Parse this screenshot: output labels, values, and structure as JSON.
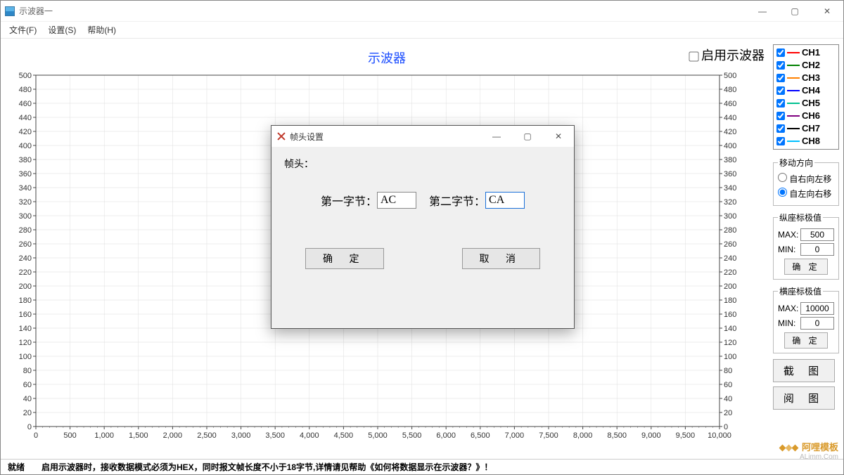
{
  "window": {
    "title": "示波器一"
  },
  "menubar": {
    "items": [
      "文件(F)",
      "设置(S)",
      "帮助(H)"
    ]
  },
  "chart": {
    "title": "示波器",
    "enable_label": "启用示波器",
    "enable_checked": false
  },
  "chart_data": {
    "type": "line",
    "title": "示波器",
    "xlabel": "",
    "ylabel": "",
    "xlim": [
      0,
      10000
    ],
    "ylim": [
      0,
      500
    ],
    "xticks": [
      0,
      500,
      1000,
      1500,
      2000,
      2500,
      3000,
      3500,
      4000,
      4500,
      5000,
      5500,
      6000,
      6500,
      7000,
      7500,
      8000,
      8500,
      9000,
      9500,
      10000
    ],
    "yticks": [
      0,
      20,
      40,
      60,
      80,
      100,
      120,
      140,
      160,
      180,
      200,
      220,
      240,
      260,
      280,
      300,
      320,
      340,
      360,
      380,
      400,
      420,
      440,
      460,
      480,
      500
    ],
    "series": [
      {
        "name": "CH1",
        "color": "#ff0000",
        "values": []
      },
      {
        "name": "CH2",
        "color": "#008000",
        "values": []
      },
      {
        "name": "CH3",
        "color": "#ff8000",
        "values": []
      },
      {
        "name": "CH4",
        "color": "#0000ff",
        "values": []
      },
      {
        "name": "CH5",
        "color": "#00c090",
        "values": []
      },
      {
        "name": "CH6",
        "color": "#800080",
        "values": []
      },
      {
        "name": "CH7",
        "color": "#000000",
        "values": []
      },
      {
        "name": "CH8",
        "color": "#00bfff",
        "values": []
      }
    ]
  },
  "side": {
    "move_group": {
      "title": "移动方向",
      "opt1": "自右向左移",
      "opt2": "自左向右移",
      "selected": 2
    },
    "y_group": {
      "title": "纵座标极值",
      "max_label": "MAX:",
      "max_value": "500",
      "min_label": "MIN:",
      "min_value": "0",
      "confirm": "确 定"
    },
    "x_group": {
      "title": "横座标极值",
      "max_label": "MAX:",
      "max_value": "10000",
      "min_label": "MIN:",
      "min_value": "0",
      "confirm": "确 定"
    },
    "btn_screenshot": "截 图",
    "btn_read": "阅 图"
  },
  "status": {
    "ready": "就绪",
    "tip": "启用示波器时，接收数据模式必须为HEX，同时报文帧长度不小于18字节,详情请见帮助《如何将数据显示在示波器？》！"
  },
  "dialog": {
    "title": "帧头设置",
    "section": "帧头：",
    "byte1_label": "第一字节：",
    "byte1_value": "AC",
    "byte2_label": "第二字节：",
    "byte2_value": "CA",
    "ok": "确  定",
    "cancel": "取  消"
  },
  "watermark": {
    "name": "阿哩模板",
    "url": "ALimm.Com"
  }
}
